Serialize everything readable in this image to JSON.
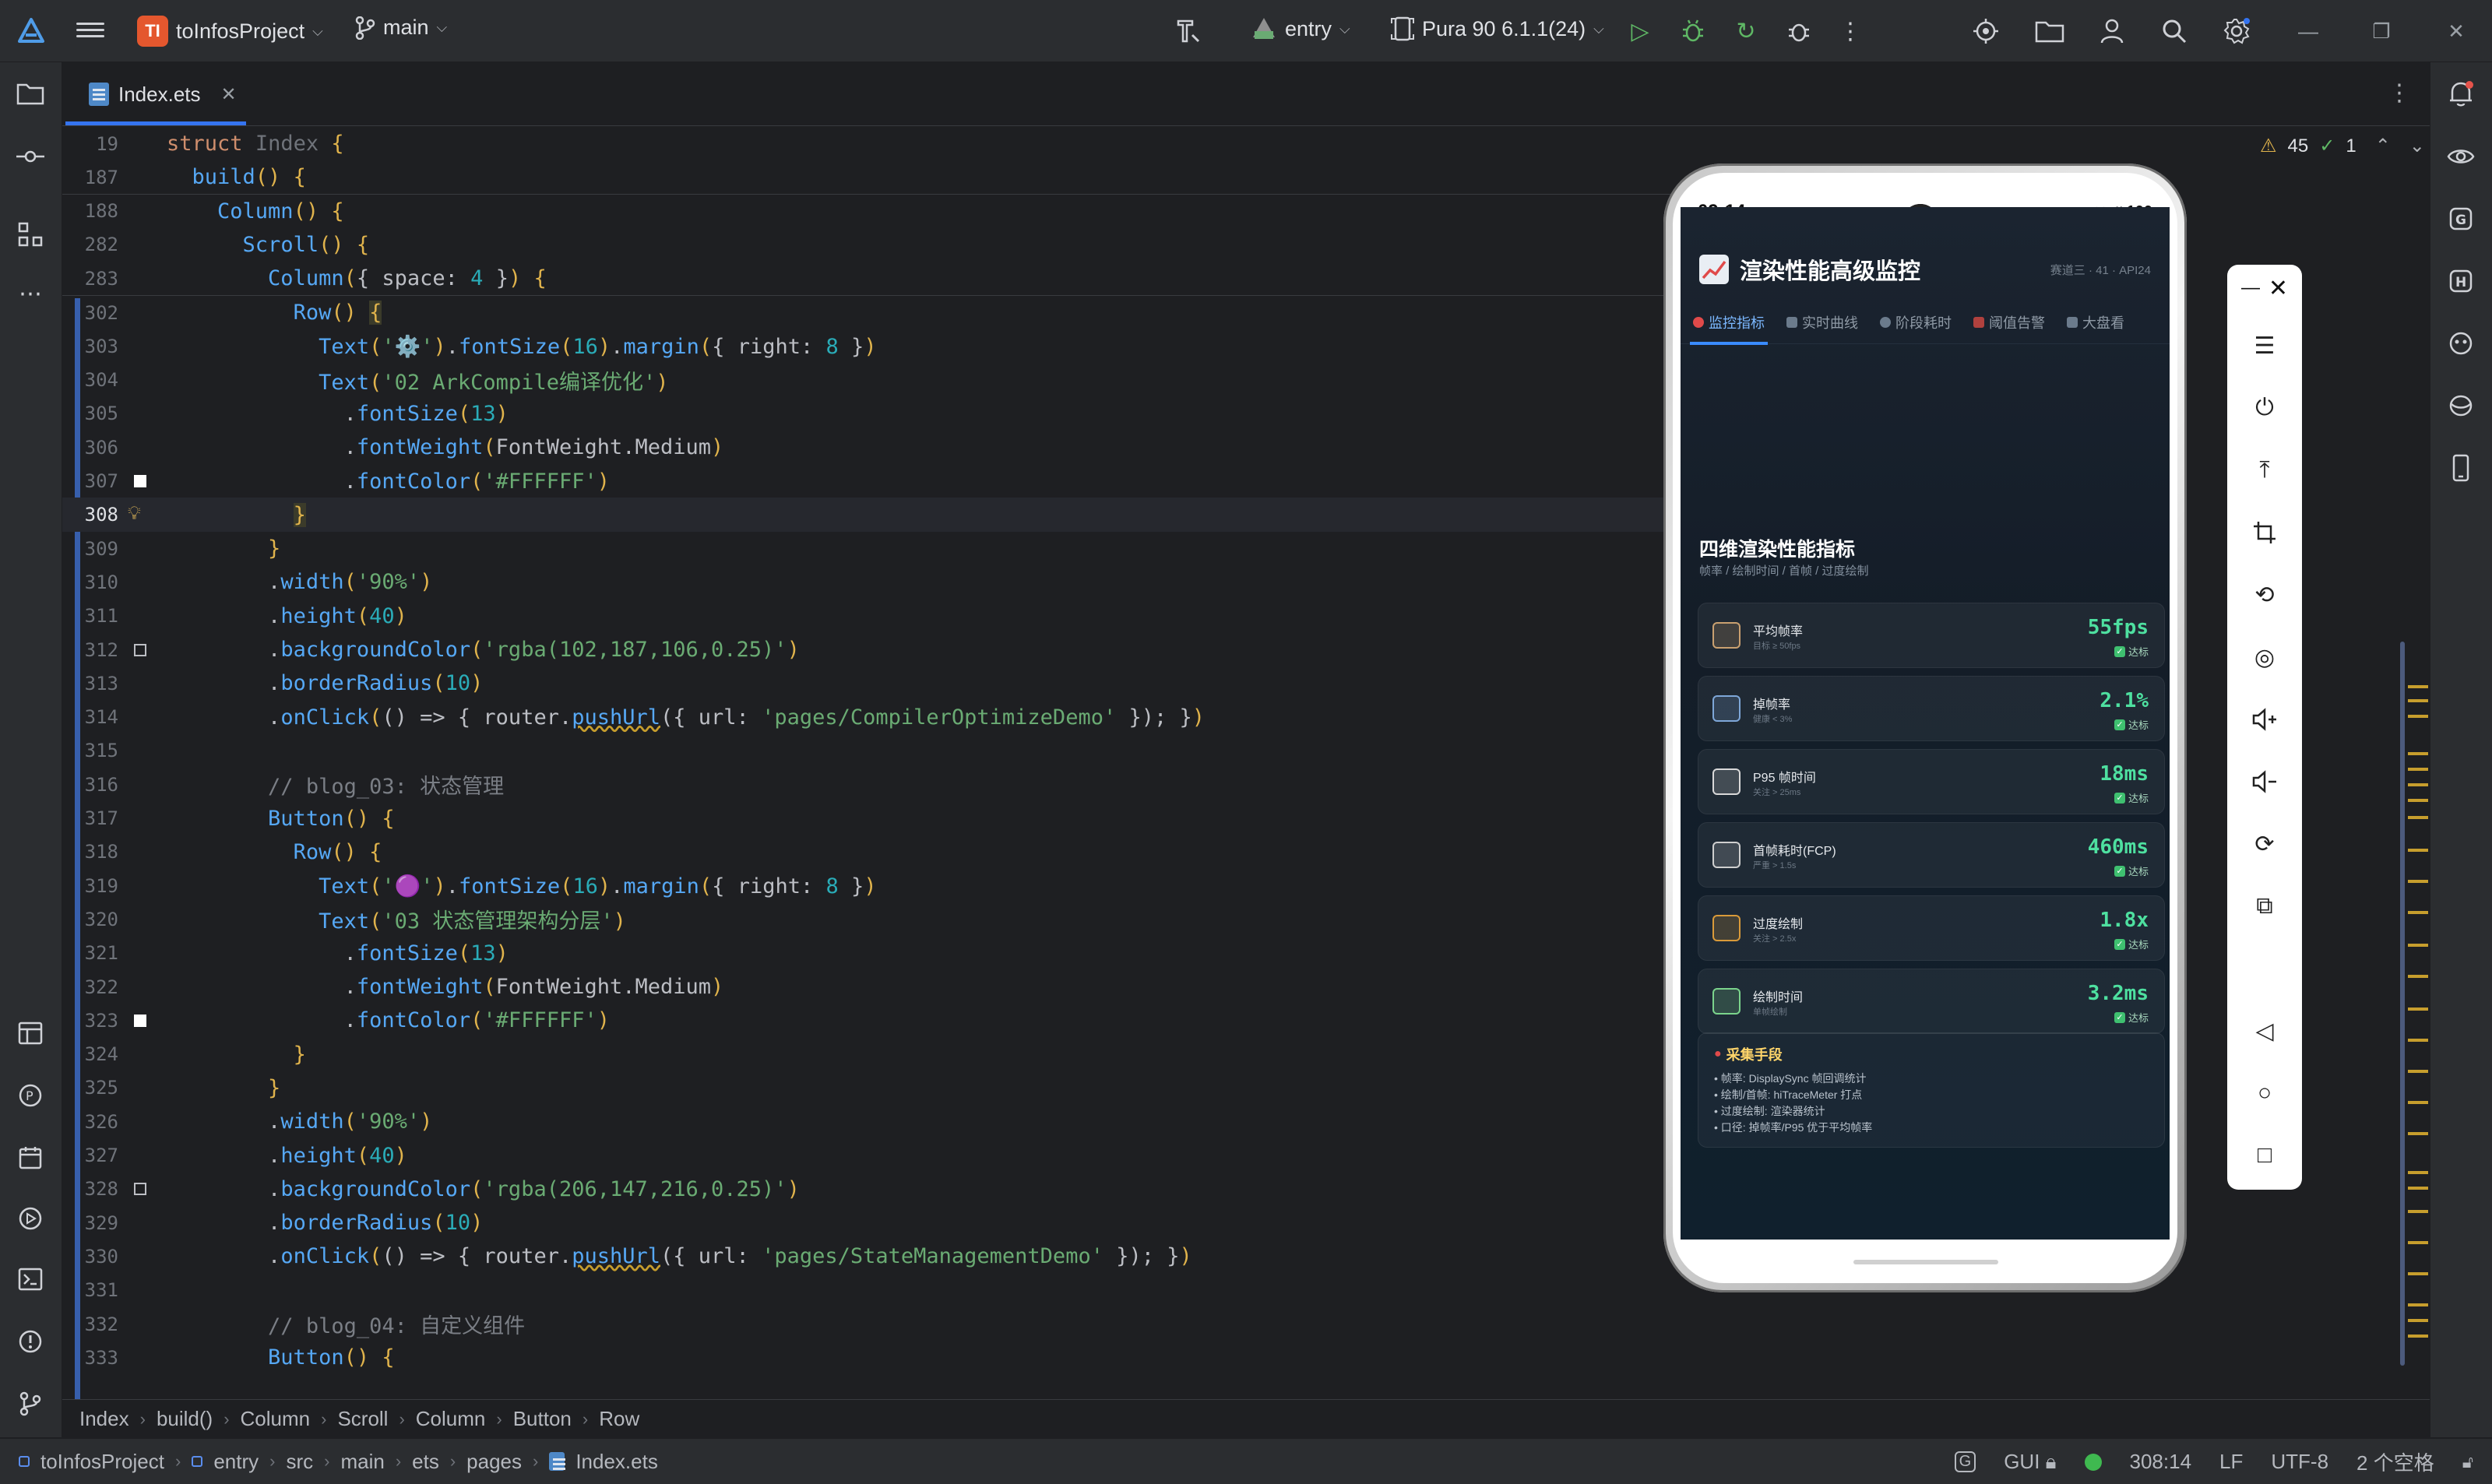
{
  "titlebar": {
    "project_badge": "TI",
    "project_name": "toInfosProject",
    "branch": "main",
    "run_config": "entry",
    "device": "Pura 90 6.1.1(24)"
  },
  "tab": {
    "file_name": "Index.ets"
  },
  "inspections": {
    "warnings": "45",
    "checks": "1"
  },
  "code_lines": [
    {
      "num": "19",
      "html": "<span class='k'>struct</span> <span class='typ' style='color:#6f737a'>Index</span> <span class='gold'>{</span>"
    },
    {
      "num": "187",
      "html": "  <span class='f'>build</span><span class='gold'>()</span> <span class='gold'>{</span>"
    },
    {
      "num": "188",
      "html": "    <span class='f'>Column</span><span class='gold'>()</span> <span class='gold'>{</span>"
    },
    {
      "num": "282",
      "html": "      <span class='f'>Scroll</span><span class='gold'>()</span> <span class='gold'>{</span>"
    },
    {
      "num": "283",
      "html": "        <span class='f'>Column</span><span class='gold'>(</span><span class='p'>{ space: </span><span class='n'>4</span><span class='p'> }</span><span class='gold'>)</span> <span class='gold'>{</span>"
    },
    {
      "num": "302",
      "html": "          <span class='f'>Row</span><span class='gold'>()</span> <span class='gold' style='background:#3b3b2a'>{</span>"
    },
    {
      "num": "303",
      "html": "            <span class='f'>Text</span><span class='gold'>(</span><span class='s'>'⚙️'</span><span class='gold'>)</span>.<span class='f'>fontSize</span><span class='gold'>(</span><span class='n'>16</span><span class='gold'>)</span>.<span class='f'>margin</span><span class='gold'>(</span>{ right: <span class='n'>8</span> }<span class='gold'>)</span>"
    },
    {
      "num": "304",
      "html": "            <span class='f'>Text</span><span class='gold'>(</span><span class='s'>'02 ArkCompile编译优化'</span><span class='gold'>)</span>"
    },
    {
      "num": "305",
      "html": "              .<span class='f'>fontSize</span><span class='gold'>(</span><span class='n'>13</span><span class='gold'>)</span>"
    },
    {
      "num": "306",
      "html": "              .<span class='f'>fontWeight</span><span class='gold'>(</span>FontWeight.Medium<span class='gold'>)</span>"
    },
    {
      "num": "307",
      "html": "              .<span class='f'>fontColor</span><span class='gold'>(</span><span class='s'>'#FFFFFF'</span><span class='gold'>)</span>"
    },
    {
      "num": "308",
      "html": "          <span class='gold' style='background:#3b3b2a'>}</span>"
    },
    {
      "num": "309",
      "html": "        <span class='gold'>}</span>"
    },
    {
      "num": "310",
      "html": "        .<span class='f'>width</span><span class='gold'>(</span><span class='s'>'90%'</span><span class='gold'>)</span>"
    },
    {
      "num": "311",
      "html": "        .<span class='f'>height</span><span class='gold'>(</span><span class='n'>40</span><span class='gold'>)</span>"
    },
    {
      "num": "312",
      "html": "        .<span class='f'>backgroundColor</span><span class='gold'>(</span><span class='s'>'rgba(102,187,106,0.25)'</span><span class='gold'>)</span>"
    },
    {
      "num": "313",
      "html": "        .<span class='f'>borderRadius</span><span class='gold'>(</span><span class='n'>10</span><span class='gold'>)</span>"
    },
    {
      "num": "314",
      "html": "        .<span class='f'>onClick</span><span class='gold'>(</span>() => { router.<span class='f' style='text-decoration:underline wavy #c79e2d'>pushUrl</span>({ url: <span class='s'>'pages/CompilerOptimizeDemo'</span> }); }<span class='gold'>)</span>"
    },
    {
      "num": "315",
      "html": ""
    },
    {
      "num": "316",
      "html": "        <span class='cm'>// blog_03: 状态管理</span>"
    },
    {
      "num": "317",
      "html": "        <span class='f'>Button</span><span class='gold'>()</span> <span class='gold'>{</span>"
    },
    {
      "num": "318",
      "html": "          <span class='f'>Row</span><span class='gold'>()</span> <span class='gold'>{</span>"
    },
    {
      "num": "319",
      "html": "            <span class='f'>Text</span><span class='gold'>(</span><span class='s'>'🟣'</span><span class='gold'>)</span>.<span class='f'>fontSize</span><span class='gold'>(</span><span class='n'>16</span><span class='gold'>)</span>.<span class='f'>margin</span><span class='gold'>(</span>{ right: <span class='n'>8</span> }<span class='gold'>)</span>"
    },
    {
      "num": "320",
      "html": "            <span class='f'>Text</span><span class='gold'>(</span><span class='s'>'03 状态管理架构分层'</span><span class='gold'>)</span>"
    },
    {
      "num": "321",
      "html": "              .<span class='f'>fontSize</span><span class='gold'>(</span><span class='n'>13</span><span class='gold'>)</span>"
    },
    {
      "num": "322",
      "html": "              .<span class='f'>fontWeight</span><span class='gold'>(</span>FontWeight.Medium<span class='gold'>)</span>"
    },
    {
      "num": "323",
      "html": "              .<span class='f'>fontColor</span><span class='gold'>(</span><span class='s'>'#FFFFFF'</span><span class='gold'>)</span>"
    },
    {
      "num": "324",
      "html": "          <span class='gold'>}</span>"
    },
    {
      "num": "325",
      "html": "        <span class='gold'>}</span>"
    },
    {
      "num": "326",
      "html": "        .<span class='f'>width</span><span class='gold'>(</span><span class='s'>'90%'</span><span class='gold'>)</span>"
    },
    {
      "num": "327",
      "html": "        .<span class='f'>height</span><span class='gold'>(</span><span class='n'>40</span><span class='gold'>)</span>"
    },
    {
      "num": "328",
      "html": "        .<span class='f'>backgroundColor</span><span class='gold'>(</span><span class='s'>'rgba(206,147,216,0.25)'</span><span class='gold'>)</span>"
    },
    {
      "num": "329",
      "html": "        .<span class='f'>borderRadius</span><span class='gold'>(</span><span class='n'>10</span><span class='gold'>)</span>"
    },
    {
      "num": "330",
      "html": "        .<span class='f'>onClick</span><span class='gold'>(</span>() => { router.<span class='f' style='text-decoration:underline wavy #c79e2d'>pushUrl</span>({ url: <span class='s'>'pages/StateManagementDemo'</span> }); }<span class='gold'>)</span>"
    },
    {
      "num": "331",
      "html": ""
    },
    {
      "num": "332",
      "html": "        <span class='cm'>// blog_04: 自定义组件</span>"
    },
    {
      "num": "333",
      "html": "        <span class='f'>Button</span><span class='gold'>()</span> <span class='gold'>{</span>"
    }
  ],
  "phone": {
    "time": "09:14",
    "status_right": "<·> ᵡ 100",
    "app_title": "渲染性能高级监控",
    "app_meta": "赛道三 · 41 · API24",
    "tabs": [
      "监控指标",
      "实时曲线",
      "阶段耗时",
      "阈值告警",
      "大盘看"
    ],
    "section_title": "四维渲染性能指标",
    "section_sub": "帧率 / 绘制时间 / 首帧 / 过度绘制",
    "metrics": [
      {
        "name": "平均帧率",
        "hint": "目标 ≥ 50fps",
        "value": "55fps",
        "badge": "达标"
      },
      {
        "name": "掉帧率",
        "hint": "健康 < 3%",
        "value": "2.1%",
        "badge": "达标"
      },
      {
        "name": "P95 帧时间",
        "hint": "关注 > 25ms",
        "value": "18ms",
        "badge": "达标"
      },
      {
        "name": "首帧耗时(FCP)",
        "hint": "严重 > 1.5s",
        "value": "460ms",
        "badge": "达标"
      },
      {
        "name": "过度绘制",
        "hint": "关注 > 2.5x",
        "value": "1.8x",
        "badge": "达标"
      },
      {
        "name": "绘制时间",
        "hint": "单帧绘制",
        "value": "3.2ms",
        "badge": "达标"
      }
    ],
    "collect_title": "采集手段",
    "collect_items": [
      "• 帧率: DisplaySync 帧回调统计",
      "• 绘制/首帧: hiTraceMeter 打点",
      "• 过度绘制: 渲染器统计",
      "• 口径: 掉帧率/P95 优于平均帧率"
    ]
  },
  "breadcrumbs": [
    "Index",
    "build()",
    "Column",
    "Scroll",
    "Column",
    "Button",
    "Row"
  ],
  "statusbar": {
    "path": [
      "toInfosProject",
      "entry",
      "src",
      "main",
      "ets",
      "pages",
      "Index.ets"
    ],
    "gui": "GUI",
    "position": "308:14",
    "line_sep": "LF",
    "encoding": "UTF-8",
    "indent": "2 个空格"
  }
}
